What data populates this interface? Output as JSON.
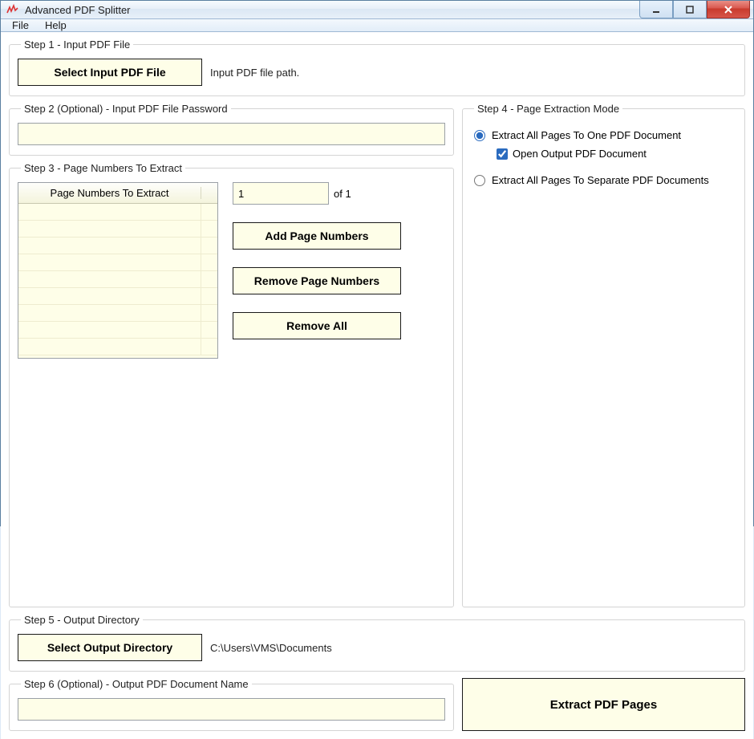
{
  "window": {
    "title": "Advanced PDF Splitter"
  },
  "menu": {
    "file": "File",
    "help": "Help"
  },
  "step1": {
    "legend": "Step 1 - Input PDF File",
    "button": "Select Input PDF File",
    "path": "Input PDF file path."
  },
  "step2": {
    "legend": "Step 2 (Optional) - Input PDF File Password",
    "value": ""
  },
  "step3": {
    "legend": "Step 3 - Page Numbers To Extract",
    "list_header": "Page Numbers To Extract",
    "page_input": "1",
    "of_label": "of 1",
    "add_btn": "Add Page Numbers",
    "remove_btn": "Remove Page Numbers",
    "remove_all_btn": "Remove All"
  },
  "step4": {
    "legend": "Step 4 - Page Extraction Mode",
    "radio1": "Extract All Pages To One PDF Document",
    "check1": "Open Output PDF Document",
    "radio2": "Extract All Pages To Separate PDF Documents"
  },
  "step5": {
    "legend": "Step 5 - Output Directory",
    "button": "Select Output Directory",
    "path": "C:\\Users\\VMS\\Documents"
  },
  "step6": {
    "legend": "Step 6 (Optional) - Output PDF Document Name",
    "value": ""
  },
  "extract_button": "Extract PDF Pages"
}
